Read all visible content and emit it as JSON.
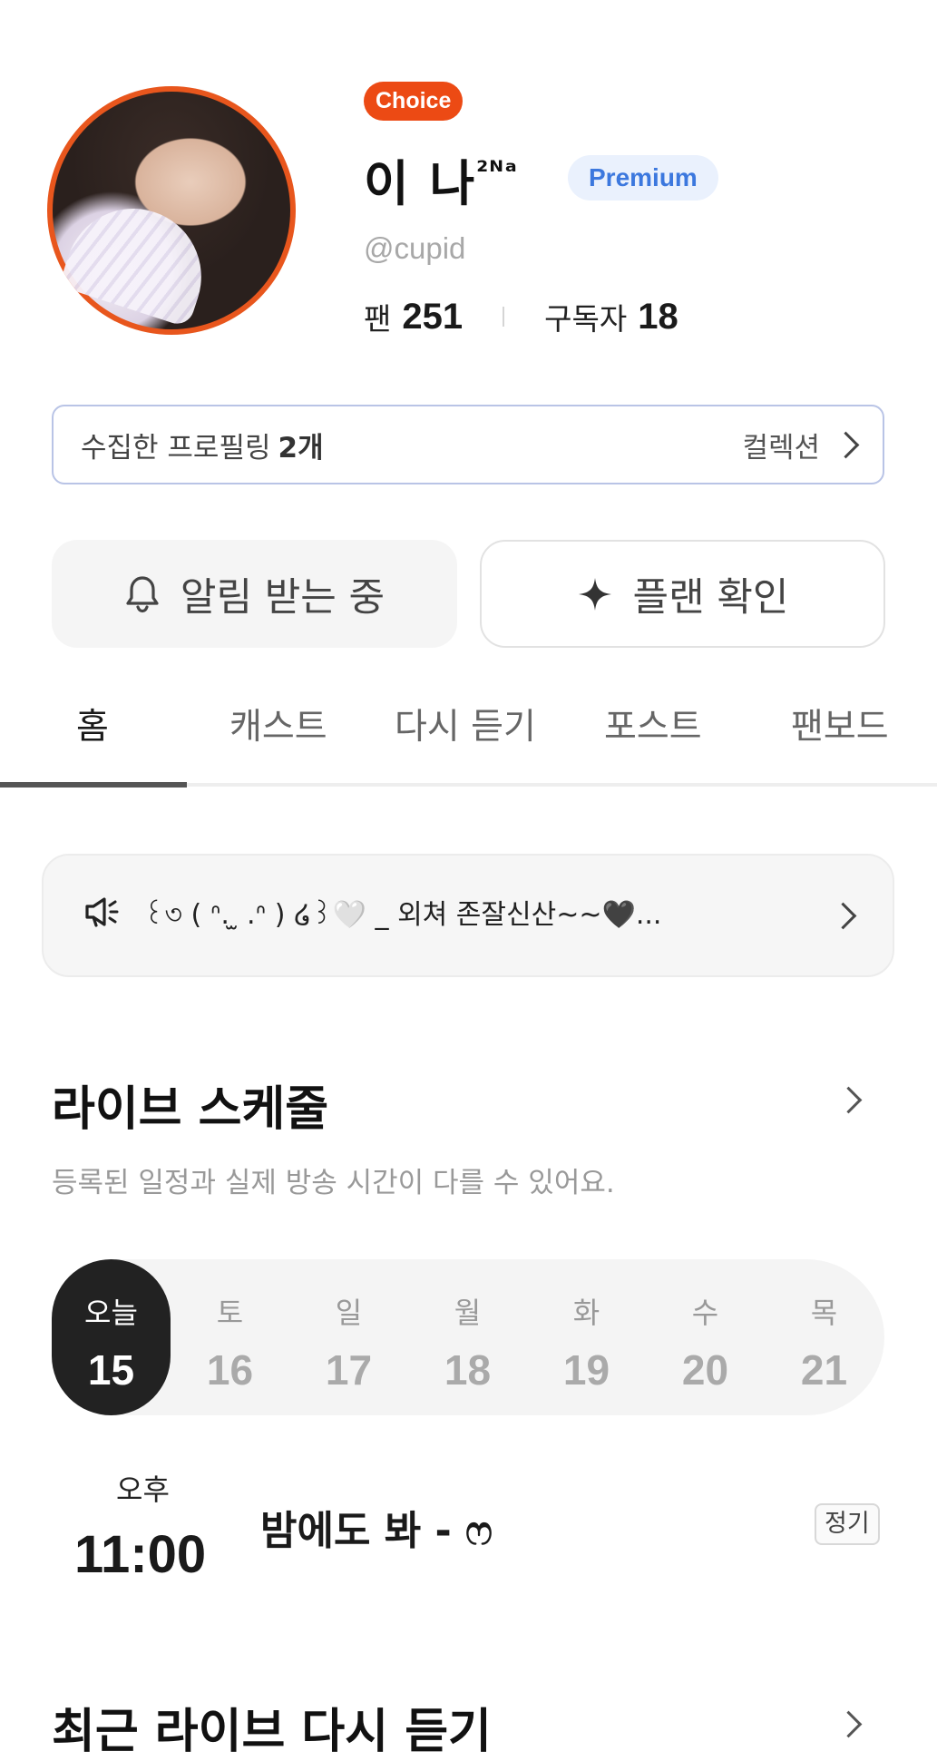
{
  "profile": {
    "badge": "Choice",
    "name": "이 나",
    "name_sup": "²ᴺᵃ",
    "tier": "Premium",
    "handle": "@cupid",
    "fans_label": "팬",
    "fans_count": "251",
    "subs_label": "구독자",
    "subs_count": "18"
  },
  "collection": {
    "label": "수집한 프로필링",
    "count": "2개",
    "link": "컬렉션"
  },
  "actions": {
    "notify": "알림 받는 중",
    "plan": "플랜 확인"
  },
  "tabs": [
    "홈",
    "캐스트",
    "다시 듣기",
    "포스트",
    "팬보드"
  ],
  "notice": {
    "text": "꒰৩ ( ᐢ. ̫ .ᐢ ) ໒꒱🤍 _ 외쳐 존잘신산~~🖤..."
  },
  "schedule": {
    "title": "라이브 스케줄",
    "subtitle": "등록된 일정과 실제 방송 시간이 다를 수 있어요.",
    "days": [
      {
        "name": "오늘",
        "date": "15"
      },
      {
        "name": "토",
        "date": "16"
      },
      {
        "name": "일",
        "date": "17"
      },
      {
        "name": "월",
        "date": "18"
      },
      {
        "name": "화",
        "date": "19"
      },
      {
        "name": "수",
        "date": "20"
      },
      {
        "name": "목",
        "date": "21"
      }
    ],
    "item": {
      "ampm": "오후",
      "time": "11:00",
      "title": "밤에도 봐 - ෆ",
      "tag": "정기"
    }
  },
  "replay": {
    "title": "최근 라이브 다시 듣기"
  },
  "colors": {
    "choice": "#ec4a14",
    "premium_text": "#3c78de",
    "premium_bg": "#eaf1fd",
    "avatar_ring": "#e8561d"
  }
}
